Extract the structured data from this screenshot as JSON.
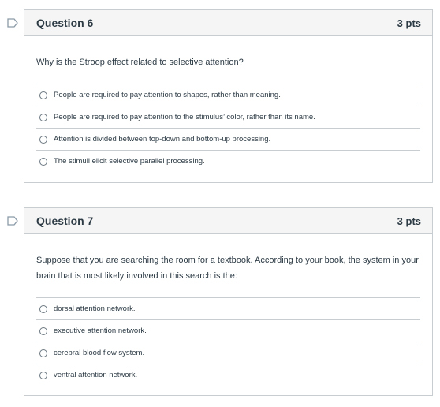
{
  "questions": [
    {
      "title": "Question 6",
      "points": "3 pts",
      "text": "Why is the Stroop effect related to selective attention?",
      "answers": [
        "People are required to pay attention to shapes, rather than meaning.",
        "People are required to pay attention to the stimulus’ color, rather than its name.",
        "Attention is divided between top-down and bottom-up processing.",
        "The stimuli elicit selective parallel processing."
      ]
    },
    {
      "title": "Question 7",
      "points": "3 pts",
      "text": "Suppose that you are searching the room for a textbook.  According to your book, the system in your brain that is most likely involved in this search is the:",
      "answers": [
        "dorsal attention network.",
        "executive attention network.",
        "cerebral blood flow system.",
        "ventral attention network."
      ]
    }
  ],
  "colors": {
    "border": "#c7cdd1",
    "header_bg": "#f5f5f5",
    "text": "#2d3b45",
    "flag_outline": "#8b9aa6"
  },
  "icons": {
    "flag": "bookmark-flag-icon",
    "radio": "radio-unselected-icon"
  }
}
